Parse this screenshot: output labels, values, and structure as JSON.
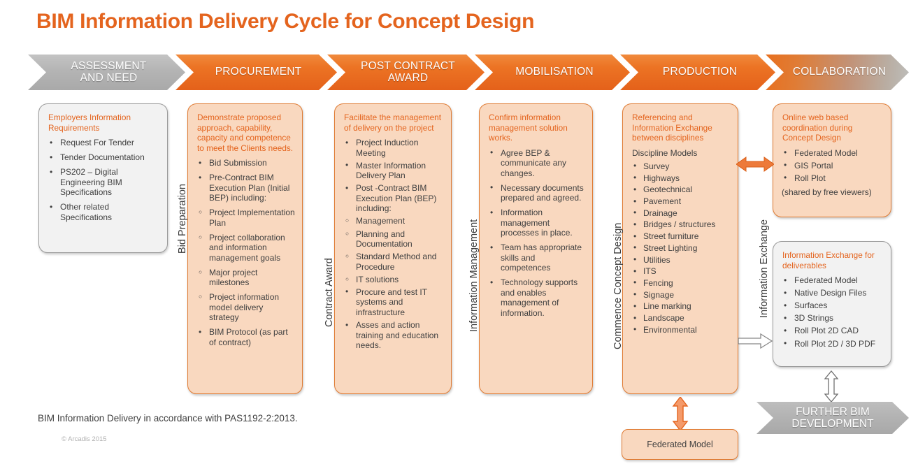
{
  "title": "BIM Information Delivery Cycle for Concept Design",
  "colors": {
    "accent_orange": "#E4641E",
    "peach_fill": "#F9D8BF",
    "peach_border": "#E07B33",
    "grey_fill": "#F2F2F2",
    "grey_border": "#9A9A9A",
    "text": "#404040"
  },
  "stages": [
    {
      "label": "ASSESSMENT AND NEED",
      "style": "grey"
    },
    {
      "label": "PROCUREMENT",
      "style": "orange"
    },
    {
      "label": "POST CONTRACT AWARD",
      "style": "orange"
    },
    {
      "label": "MOBILISATION",
      "style": "orange"
    },
    {
      "label": "PRODUCTION",
      "style": "orange"
    },
    {
      "label": "COLLABORATION",
      "style": "fade"
    }
  ],
  "stage_lines": {
    "s0a": "ASSESSMENT",
    "s0b": "AND NEED",
    "s1": "PROCUREMENT",
    "s2a": "POST CONTRACT",
    "s2b": "AWARD",
    "s3": "MOBILISATION",
    "s4": "PRODUCTION",
    "s5": "COLLABORATION"
  },
  "side_labels": {
    "bid_preparation": "Bid Preparation",
    "contract_award": "Contract Award",
    "information_management": "Information Management",
    "commence_concept_design": "Commence Concept Design",
    "information_exchange": "Information Exchange"
  },
  "cards": {
    "assessment": {
      "heading": "Employers Information Requirements",
      "items": [
        {
          "text": "Request For Tender",
          "level": "bullet"
        },
        {
          "text": "Tender Documentation",
          "level": "bullet"
        },
        {
          "text": "PS202 – Digital Engineering BIM Specifications",
          "level": "bullet"
        },
        {
          "text": "Other related Specifications",
          "level": "bullet"
        }
      ]
    },
    "procurement": {
      "heading": "Demonstrate proposed approach, capability, capacity and competence to meet the Clients needs.",
      "items": [
        {
          "text": "Bid Submission",
          "level": "bullet"
        },
        {
          "text": "Pre-Contract BIM Execution Plan (Initial BEP) including:",
          "level": "bullet"
        },
        {
          "text": "Project Implementation Plan",
          "level": "sub"
        },
        {
          "text": "Project collaboration and information management goals",
          "level": "sub"
        },
        {
          "text": "Major project milestones",
          "level": "sub"
        },
        {
          "text": "Project information model delivery strategy",
          "level": "sub"
        },
        {
          "text": "BIM Protocol (as part of contract)",
          "level": "bullet"
        }
      ]
    },
    "post_contract": {
      "heading": "Facilitate the management of delivery on the project",
      "items": [
        {
          "text": "Project Induction Meeting",
          "level": "bullet"
        },
        {
          "text": "Master Information Delivery Plan",
          "level": "bullet"
        },
        {
          "text": "Post -Contract BIM Execution Plan (BEP) including:",
          "level": "bullet"
        },
        {
          "text": "Management",
          "level": "sub"
        },
        {
          "text": "Planning and Documentation",
          "level": "sub"
        },
        {
          "text": "Standard Method and Procedure",
          "level": "sub"
        },
        {
          "text": "IT solutions",
          "level": "sub"
        },
        {
          "text": "Procure and test IT systems and infrastructure",
          "level": "bullet"
        },
        {
          "text": "Asses and action training and education needs.",
          "level": "bullet"
        }
      ]
    },
    "mobilisation": {
      "heading": "Confirm information management solution works.",
      "items": [
        {
          "text": "Agree BEP & communicate any changes.",
          "level": "bullet"
        },
        {
          "text": "Necessary documents prepared and agreed.",
          "level": "bullet"
        },
        {
          "text": "Information management processes in place.",
          "level": "bullet"
        },
        {
          "text": "Team has appropriate skills and competences",
          "level": "bullet"
        },
        {
          "text": "Technology supports and enables management of information.",
          "level": "bullet"
        }
      ]
    },
    "production": {
      "heading": "Referencing and Information Exchange between disciplines",
      "subheading": "Discipline Models",
      "items": [
        {
          "text": "Survey",
          "level": "bullet"
        },
        {
          "text": "Highways",
          "level": "bullet"
        },
        {
          "text": "Geotechnical",
          "level": "bullet"
        },
        {
          "text": "Pavement",
          "level": "bullet"
        },
        {
          "text": "Drainage",
          "level": "bullet"
        },
        {
          "text": "Bridges / structures",
          "level": "bullet"
        },
        {
          "text": "Street furniture",
          "level": "bullet"
        },
        {
          "text": "Street Lighting",
          "level": "bullet"
        },
        {
          "text": "Utilities",
          "level": "bullet"
        },
        {
          "text": "ITS",
          "level": "bullet"
        },
        {
          "text": "Fencing",
          "level": "bullet"
        },
        {
          "text": "Signage",
          "level": "bullet"
        },
        {
          "text": "Line marking",
          "level": "bullet"
        },
        {
          "text": "Landscape",
          "level": "bullet"
        },
        {
          "text": "Environmental",
          "level": "bullet"
        }
      ]
    },
    "collaboration_online": {
      "heading": "Online web based coordination during Concept Design",
      "items": [
        {
          "text": "Federated Model",
          "level": "bullet"
        },
        {
          "text": "GIS Portal",
          "level": "bullet"
        },
        {
          "text": "Roll Plot",
          "level": "bullet"
        }
      ],
      "note": "(shared by free viewers)"
    },
    "collaboration_deliverables": {
      "heading": "Information Exchange for deliverables",
      "items": [
        {
          "text": "Federated Model",
          "level": "bullet"
        },
        {
          "text": "Native Design Files",
          "level": "bullet"
        },
        {
          "text": "Surfaces",
          "level": "bullet"
        },
        {
          "text": "3D Strings",
          "level": "bullet"
        },
        {
          "text": "Roll Plot 2D CAD",
          "level": "bullet"
        },
        {
          "text": "Roll Plot 2D / 3D PDF",
          "level": "bullet"
        }
      ]
    }
  },
  "federated_model_box": "Federated Model",
  "further_development": {
    "line1": "FURTHER BIM",
    "line2": "DEVELOPMENT"
  },
  "footer": {
    "note": "BIM Information Delivery in accordance with PAS1192-2:2013.",
    "copyright": "© Arcadis 2015"
  },
  "icons": {
    "double_arrow_horizontal_orange": "double-arrow-horizontal-icon",
    "arrow_right_outline": "arrow-right-outline-icon",
    "double_arrow_vertical_orange": "double-arrow-vertical-icon",
    "double_arrow_vertical_outline": "double-arrow-vertical-outline-icon"
  }
}
